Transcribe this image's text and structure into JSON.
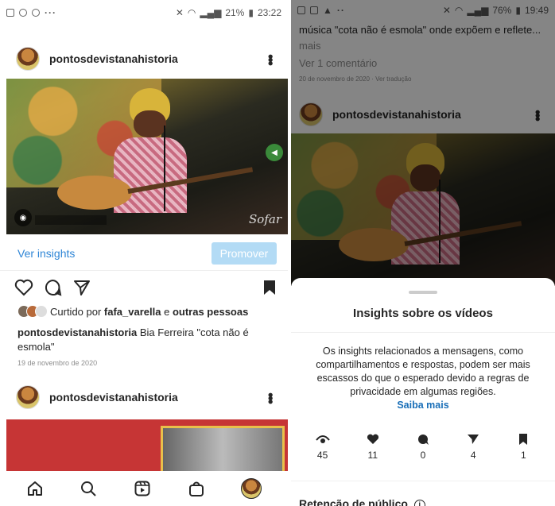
{
  "left": {
    "status": {
      "percent": "21%",
      "time": "23:22"
    },
    "post1": {
      "username": "pontosdevistanahistoria",
      "watermark": "Sofar",
      "insights_link": "Ver insights",
      "promote_button": "Promover",
      "liked_prefix": "Curtido por ",
      "liked_user": "fafa_varella",
      "liked_join": " e ",
      "liked_others": "outras pessoas",
      "caption_user": "pontosdevistanahistoria",
      "caption_text": " Bia Ferreira \"cota não é esmola\"",
      "date": "19 de novembro de 2020"
    },
    "post2": {
      "username": "pontosdevistanahistoria"
    }
  },
  "right": {
    "status": {
      "percent": "76%",
      "time": "19:49"
    },
    "caption_line": "música \"cota não é esmola\" onde expõem e reflete...",
    "more": "mais",
    "comments_link": "Ver 1 comentário",
    "date_line": "20 de novembro de 2020 · Ver tradução",
    "post_username": "pontosdevistanahistoria",
    "sheet": {
      "title": "Insights sobre os vídeos",
      "info": "Os insights relacionados a mensagens, como compartilhamentos e respostas, podem ser mais escassos do que o esperado devido a regras de privacidade em algumas regiões.",
      "learn_more": "Saiba mais",
      "stats": [
        {
          "icon": "eye-icon",
          "value": "45"
        },
        {
          "icon": "heart-icon",
          "value": "11"
        },
        {
          "icon": "comment-icon",
          "value": "0"
        },
        {
          "icon": "send-icon",
          "value": "4"
        },
        {
          "icon": "bookmark-icon",
          "value": "1"
        }
      ],
      "retention": "Retenção de público"
    }
  }
}
